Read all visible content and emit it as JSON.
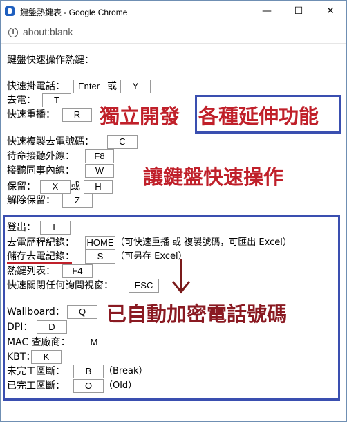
{
  "window": {
    "title": "鍵盤熱鍵表 - Google Chrome",
    "minimize": "—",
    "maximize": "☐",
    "close": "✕"
  },
  "address_bar": {
    "url": "about:blank",
    "info_glyph": "i"
  },
  "heading": "鍵盤快速操作熱鍵：",
  "section1": [
    {
      "label": "快速掛電話：",
      "keys": [
        "Enter",
        "Y"
      ],
      "sep": "或"
    },
    {
      "label": "去電：",
      "keys": [
        "T"
      ]
    },
    {
      "label": "快速重播：",
      "keys": [
        "R"
      ]
    }
  ],
  "section2": [
    {
      "label": "快速複製去電號碼：",
      "keys": [
        "C"
      ]
    },
    {
      "label": "待命接聽外線：",
      "keys": [
        "F8"
      ]
    },
    {
      "label": "接聽同事內線：",
      "keys": [
        "W"
      ]
    },
    {
      "label": "保留：",
      "keys": [
        "X",
        "H"
      ],
      "sep": "或"
    },
    {
      "label": "解除保留：",
      "keys": [
        "Z"
      ]
    }
  ],
  "section3": [
    {
      "label": "登出：",
      "keys": [
        "L"
      ]
    },
    {
      "label": "去電歷程紀錄：",
      "keys": [
        "HOME"
      ],
      "note": "（可快速重播 或 複製號碼，可匯出 Excel）"
    },
    {
      "label": "儲存去電記錄：",
      "keys": [
        "S"
      ],
      "note": "（可另存 Excel）"
    },
    {
      "label": "熱鍵列表：",
      "keys": [
        "F4"
      ]
    },
    {
      "label": "快速關閉任何詢問視窗：",
      "keys": [
        "ESC"
      ]
    },
    {
      "label": "Wallboard：",
      "keys": [
        "Q"
      ]
    },
    {
      "label": "DPI：",
      "keys": [
        "D"
      ]
    },
    {
      "label": "MAC 查廠商：",
      "keys": [
        "M"
      ]
    },
    {
      "label": "KBT：",
      "keys": [
        "K"
      ]
    },
    {
      "label": "未完工區斷：",
      "keys": [
        "B"
      ],
      "note": "（Break）"
    },
    {
      "label": "已完工區斷：",
      "keys": [
        "O"
      ],
      "note": "（Old）"
    }
  ],
  "annotations": {
    "feature_text_left": "獨立開發",
    "feature_text_boxed": "各種延伸功能",
    "keyboard_text": "讓鍵盤快速操作",
    "encrypt_text": "已自動加密電話號碼",
    "color_red": "#c0202a",
    "color_blue": "#3a4fb0"
  }
}
